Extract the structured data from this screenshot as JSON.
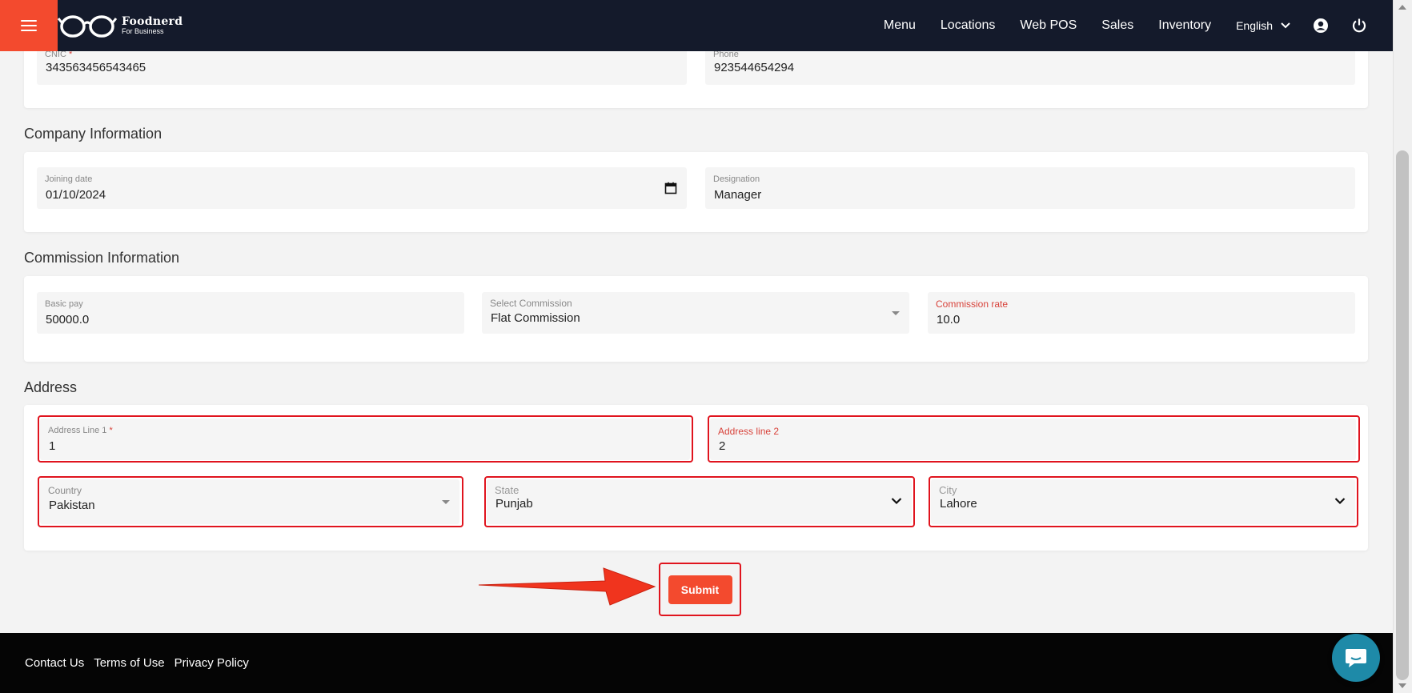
{
  "brand": {
    "name": "Foodnerd",
    "tagline": "For Business"
  },
  "nav": {
    "links": [
      "Menu",
      "Locations",
      "Web POS",
      "Sales",
      "Inventory"
    ],
    "language": "English"
  },
  "top_fields": {
    "cnic": {
      "label": "CNIC",
      "required": "*",
      "value": "343563456543465"
    },
    "phone": {
      "label": "Phone",
      "value": "923544654294"
    }
  },
  "company": {
    "title": "Company Information",
    "joining_date": {
      "label": "Joining date",
      "value": "01/10/2024"
    },
    "designation": {
      "label": "Designation",
      "value": "Manager"
    }
  },
  "commission": {
    "title": "Commission Information",
    "basic_pay": {
      "label": "Basic pay",
      "value": "50000.0"
    },
    "select_commission": {
      "label": "Select Commission",
      "value": "Flat Commission"
    },
    "commission_rate": {
      "label": "Commission rate",
      "value": "10.0"
    }
  },
  "address": {
    "title": "Address",
    "line1": {
      "label": "Address Line 1",
      "required": "*",
      "value": "1"
    },
    "line2": {
      "label": "Address line 2",
      "value": "2"
    },
    "country": {
      "label": "Country",
      "value": "Pakistan"
    },
    "state": {
      "label": "State",
      "value": "Punjab"
    },
    "city": {
      "label": "City",
      "value": "Lahore"
    }
  },
  "submit_label": "Submit",
  "footer": {
    "links": [
      "Contact Us",
      "Terms of Use",
      "Privacy Policy"
    ]
  },
  "colors": {
    "accent": "#f34a2e",
    "nav_bg": "#141a2b",
    "highlight": "#e0141e",
    "error_label": "#d8423a",
    "chat": "#1e8aa8"
  },
  "icons": [
    "menu-icon",
    "glasses-logo-icon",
    "chevron-down-icon",
    "account-circle-icon",
    "power-icon",
    "calendar-icon",
    "dropdown-caret-icon",
    "chat-icon",
    "annotation-arrow"
  ]
}
